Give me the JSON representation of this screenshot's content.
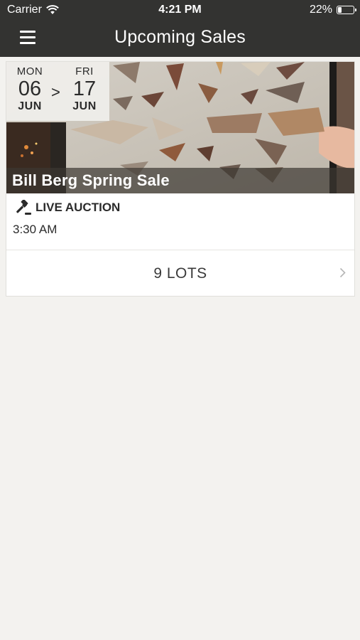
{
  "status_bar": {
    "carrier": "Carrier",
    "time": "4:21 PM",
    "battery": "22%",
    "battery_level": 0.22
  },
  "nav": {
    "title": "Upcoming Sales",
    "menu_icon": "hamburger-menu-icon"
  },
  "sale": {
    "start": {
      "dow": "MON",
      "day": "06",
      "month": "JUN"
    },
    "separator": ">",
    "end": {
      "dow": "FRI",
      "day": "17",
      "month": "JUN"
    },
    "title": "Bill Berg Spring Sale",
    "type_label": "LIVE AUCTION",
    "type_icon": "gavel-icon",
    "time": "3:30 AM",
    "lots_label": "9 LOTS"
  },
  "colors": {
    "bar_background": "#333331",
    "page_background": "#f3f2ef",
    "card_background": "#ffffff"
  }
}
